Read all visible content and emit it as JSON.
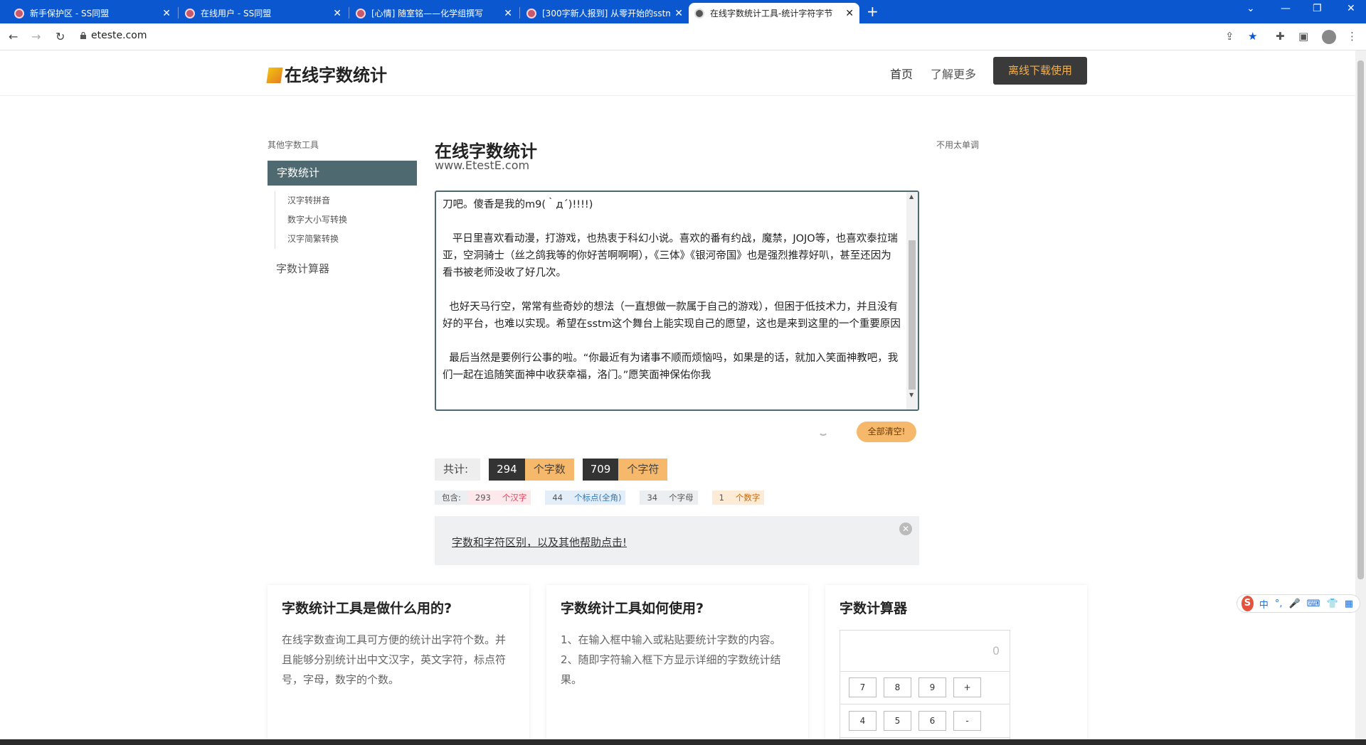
{
  "browser": {
    "tabs": [
      {
        "title": "新手保护区 - SS同盟"
      },
      {
        "title": "在线用户 - SS同盟"
      },
      {
        "title": "[心情] 随室铭——化学组撰写"
      },
      {
        "title": "[300字新人报到] 从零开始的sstm"
      },
      {
        "title": "在线字数统计工具-统计字符字节"
      }
    ],
    "url": "eteste.com"
  },
  "header": {
    "logo": "在线字数统计",
    "nav_home": "首页",
    "nav_more": "了解更多",
    "download": "离线下载使用"
  },
  "sidebar": {
    "caption": "其他字数工具",
    "active": "字数统计",
    "subitems": [
      "汉字转拼音",
      "数字大小写转换",
      "汉字简繁转换"
    ],
    "calculator": "字数计算器"
  },
  "right_caption": "不用太单调",
  "main": {
    "title": "在线字数统计",
    "subtitle": "www.EtestE.com",
    "editor_text": "       从名字也可以看出来，杀也是一名个音究，岁想是吊看个音动遍世界美食（所以，各位情敌，拔刀吧。傻香是我的m9(｀д´)!!!!)\n\n   平日里喜欢看动漫，打游戏，也热衷于科幻小说。喜欢的番有约战，魔禁，JOJO等，也喜欢泰拉瑞亚，空洞骑士（丝之鸽我等的你好苦啊啊啊），《三体》《银河帝国》也是强烈推荐好叭，甚至还因为看书被老师没收了好几次。\n\n  也好天马行空，常常有些奇妙的想法（一直想做一款属于自己的游戏），但困于低技术力，并且没有好的平台，也难以实现。希望在sstm这个舞台上能实现自己的愿望，这也是来到这里的一个重要原因\n\n  最后当然是要例行公事的啦。“你最近有为诸事不顺而烦恼吗，如果是的话，就加入笑面神教吧，我们一起在追随笑面神中收获幸福，洛门。”愿笑面神保佑你我",
    "clear_button": "全部清空!",
    "total_label": "共计:",
    "word_count": "294",
    "word_unit": "个字数",
    "char_count": "709",
    "char_unit": "个字符",
    "contains_label": "包含:",
    "details": [
      {
        "num": "293",
        "unit": "个汉字",
        "color": "#e0415a",
        "bg": "#fde8eb"
      },
      {
        "num": "44",
        "unit": "个标点(全角)",
        "color": "#2f7bbf",
        "bg": "#e3eef8"
      },
      {
        "num": "34",
        "unit": "个字母",
        "color": "#555555",
        "bg": "#eceff1"
      },
      {
        "num": "1",
        "unit": "个数字",
        "color": "#c06a12",
        "bg": "#fdebd6"
      }
    ],
    "info_link": "字数和字符区别，以及其他帮助点击!"
  },
  "cards": [
    {
      "title": "字数统计工具是做什么用的?",
      "body": "在线字数查询工具可方便的统计出字符个数。并且能够分别统计出中文汉字，英文字符，标点符号，字母，数字的个数。"
    },
    {
      "title": "字数统计工具如何使用?",
      "body": "1、在输入框中输入或粘贴要统计字数的内容。\n2、随即字符输入框下方显示详细的字数统计结果。"
    },
    {
      "title": "字数计算器",
      "display": "0",
      "keys_row1": [
        "7",
        "8",
        "9",
        "+"
      ],
      "keys_row2": [
        "4",
        "5",
        "6",
        "-"
      ]
    }
  ],
  "ime": {
    "logo": "S",
    "lang": "中"
  }
}
